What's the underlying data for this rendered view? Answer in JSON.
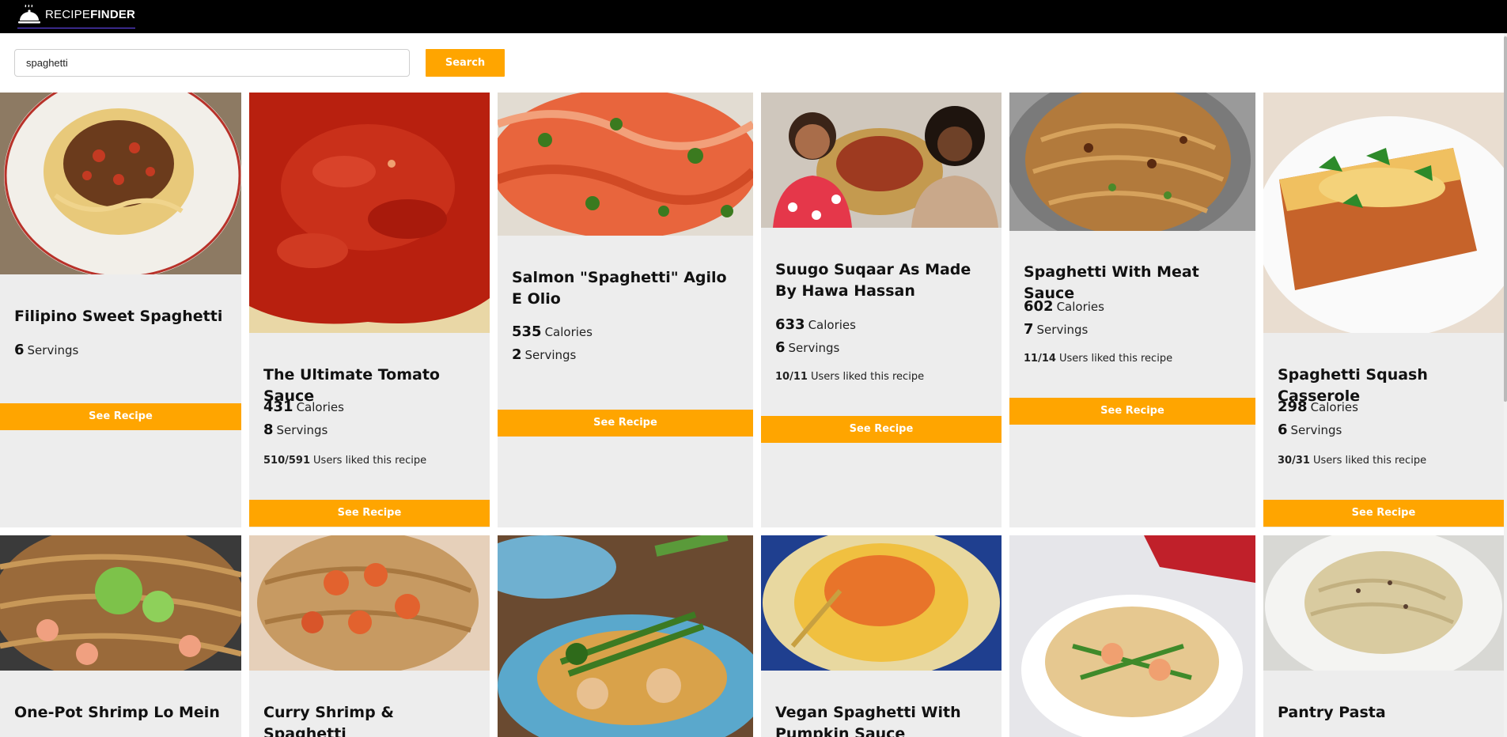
{
  "app": {
    "brand_light": "RECIPE",
    "brand_bold": "FINDER"
  },
  "search": {
    "value": "spaghetti",
    "button_label": "Search"
  },
  "colors": {
    "accent": "#ffa500",
    "topbar": "#000000",
    "card_bg": "#ededed"
  },
  "cards": [
    {
      "title": "Filipino Sweet Spaghetti",
      "calories": null,
      "servings": "6",
      "likes": null,
      "servings_label": "Servings",
      "button": "See Recipe",
      "photo_icon": "spaghetti-plate-photo"
    },
    {
      "title": "The Ultimate Tomato Sauce",
      "calories": "431",
      "calories_label": "Calories",
      "servings": "8",
      "servings_label": "Servings",
      "likes": "510/591",
      "likes_label": "Users liked this recipe",
      "button": "See Recipe",
      "photo_icon": "tomato-sauce-photo"
    },
    {
      "title": "Salmon \"Spaghetti\" Agilo E Olio",
      "calories": "535",
      "calories_label": "Calories",
      "servings": "2",
      "servings_label": "Servings",
      "likes": null,
      "button": "See Recipe",
      "photo_icon": "salmon-photo"
    },
    {
      "title": "Suugo Suqaar As Made By Hawa Hassan",
      "calories": "633",
      "calories_label": "Calories",
      "servings": "6",
      "servings_label": "Servings",
      "likes": "10/11",
      "likes_label": "Users liked this recipe",
      "button": "See Recipe",
      "photo_icon": "people-pasta-photo"
    },
    {
      "title": "Spaghetti With Meat Sauce",
      "calories": "602",
      "calories_label": "Calories",
      "servings": "7",
      "servings_label": "Servings",
      "likes": "11/14",
      "likes_label": "Users liked this recipe",
      "button": "See Recipe",
      "photo_icon": "meat-sauce-pan-photo"
    },
    {
      "title": "Spaghetti Squash Casserole",
      "calories": "298",
      "calories_label": "Calories",
      "servings": "6",
      "servings_label": "Servings",
      "likes": "30/31",
      "likes_label": "Users liked this recipe",
      "button": "See Recipe",
      "photo_icon": "casserole-photo"
    },
    {
      "title": "One-Pot Shrimp Lo Mein",
      "photo_icon": "lo-mein-photo"
    },
    {
      "title": "Curry Shrimp & Spaghetti",
      "photo_icon": "curry-shrimp-photo"
    },
    {
      "title": "",
      "photo_icon": "stir-fry-photo"
    },
    {
      "title": "Vegan Spaghetti With Pumpkin Sauce",
      "photo_icon": "pumpkin-sauce-photo"
    },
    {
      "title": "",
      "photo_icon": "shrimp-bowl-photo"
    },
    {
      "title": "Pantry Pasta",
      "photo_icon": "pantry-pasta-photo"
    }
  ]
}
